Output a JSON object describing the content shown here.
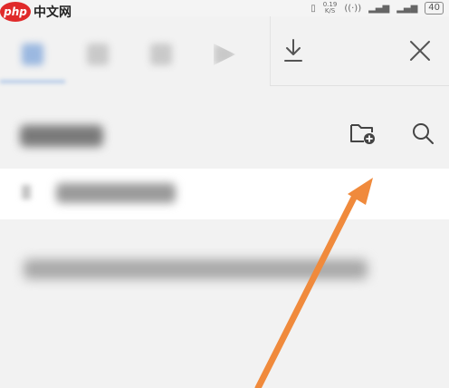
{
  "watermark": {
    "badge": "php",
    "text": "中文网"
  },
  "status_bar": {
    "speed_top": "0.19",
    "speed_unit": "K/S",
    "battery": "40"
  },
  "toolbar": {
    "download_icon": "download-icon",
    "close_icon": "close-icon",
    "new_folder_icon": "folder-add-icon",
    "search_icon": "search-icon"
  },
  "header": {
    "title": ""
  },
  "folder_row": {
    "label": ""
  },
  "empty_hint": "",
  "colors": {
    "background": "#f2f2f2",
    "row_background": "#ffffff",
    "active_tab": "#9bb8e0",
    "annotation_arrow": "#f08a3c"
  }
}
